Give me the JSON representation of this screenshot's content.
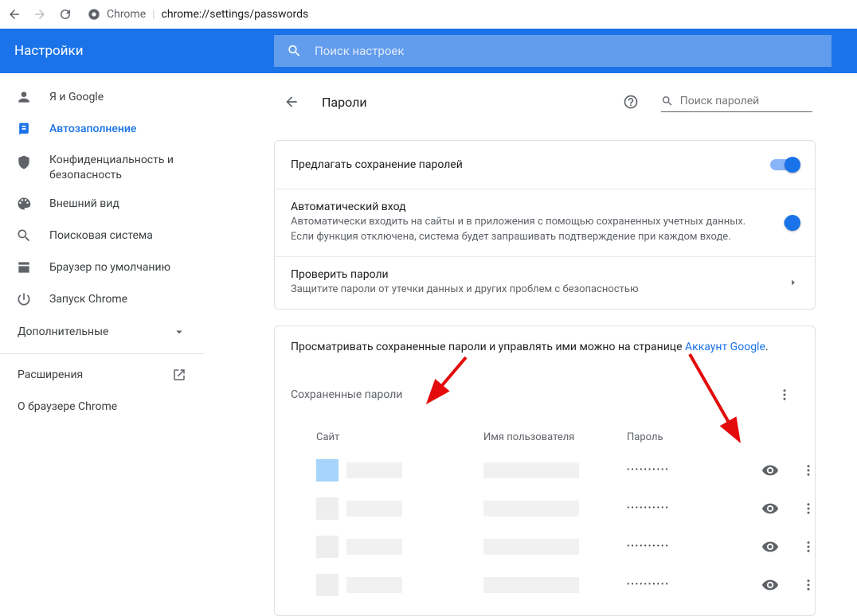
{
  "browser": {
    "product": "Chrome",
    "url": "chrome://settings/passwords"
  },
  "header": {
    "title": "Настройки",
    "search_placeholder": "Поиск настроек"
  },
  "sidebar": {
    "items": [
      {
        "label": "Я и Google"
      },
      {
        "label": "Автозаполнение"
      },
      {
        "label": "Конфиденциальность и безопасность"
      },
      {
        "label": "Внешний вид"
      },
      {
        "label": "Поисковая система"
      },
      {
        "label": "Браузер по умолчанию"
      },
      {
        "label": "Запуск Chrome"
      }
    ],
    "advanced": "Дополнительные",
    "extensions": "Расширения",
    "about": "О браузере Chrome"
  },
  "page": {
    "title": "Пароли",
    "local_search_placeholder": "Поиск паролей"
  },
  "settings": {
    "offer_save": {
      "title": "Предлагать сохранение паролей"
    },
    "auto_signin": {
      "title": "Автоматический вход",
      "desc": "Автоматически входить на сайты и в приложения с помощью сохраненных учетных данных. Если функция отключена, система будет запрашивать подтверждение при каждом входе."
    },
    "check_passwords": {
      "title": "Проверить пароли",
      "desc": "Защитите пароли от утечки данных и других проблем с безопасностью"
    },
    "manage": {
      "prefix": "Просматривать сохраненные пароли и управлять ими можно на странице ",
      "link": "Аккаунт Google",
      "suffix": "."
    }
  },
  "saved": {
    "title": "Сохраненные пароли",
    "columns": {
      "site": "Сайт",
      "user": "Имя пользователя",
      "pass": "Пароль"
    },
    "rows": [
      {
        "masked": "••••••••••"
      },
      {
        "masked": "••••••••••"
      },
      {
        "masked": "••••••••••"
      },
      {
        "masked": "••••••••••"
      }
    ]
  }
}
